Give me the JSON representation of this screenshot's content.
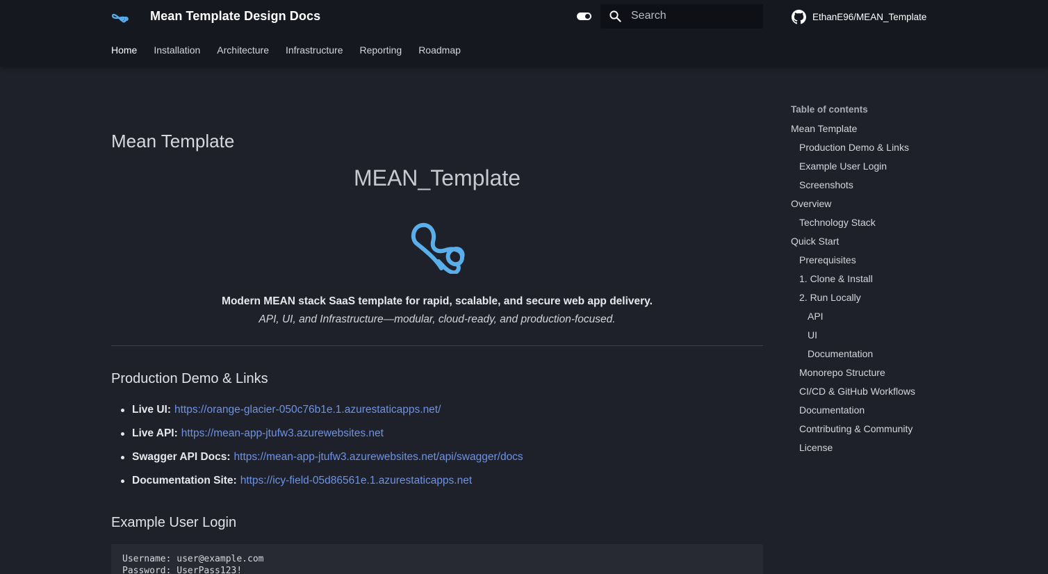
{
  "header": {
    "site_title": "Mean Template Design Docs",
    "search_placeholder": "Search",
    "repo_name": "EthanE96/MEAN_Template",
    "tabs": [
      {
        "label": "Home",
        "active": true
      },
      {
        "label": "Installation"
      },
      {
        "label": "Architecture"
      },
      {
        "label": "Infrastructure"
      },
      {
        "label": "Reporting"
      },
      {
        "label": "Roadmap"
      }
    ]
  },
  "main": {
    "page_title": "Mean Template",
    "center_title": "MEAN_Template",
    "tagline": "Modern MEAN stack SaaS template for rapid, scalable, and secure web app delivery.",
    "subtagline": "API, UI, and Infrastructure—modular, cloud-ready, and production-focused.",
    "section_demo_title": "Production Demo & Links",
    "links": [
      {
        "label": "Live UI:",
        "url": "https://orange-glacier-050c76b1e.1.azurestaticapps.net/"
      },
      {
        "label": "Live API:",
        "url": "https://mean-app-jtufw3.azurewebsites.net"
      },
      {
        "label": "Swagger API Docs:",
        "url": "https://mean-app-jtufw3.azurewebsites.net/api/swagger/docs"
      },
      {
        "label": "Documentation Site:",
        "url": "https://icy-field-05d86561e.1.azurestaticapps.net"
      }
    ],
    "section_login_title": "Example User Login",
    "code_lines": [
      "Username: user@example.com",
      "Password: UserPass123!"
    ]
  },
  "toc": {
    "title": "Table of contents",
    "items": [
      {
        "label": "Mean Template",
        "level": 1
      },
      {
        "label": "Production Demo & Links",
        "level": 2
      },
      {
        "label": "Example User Login",
        "level": 2
      },
      {
        "label": "Screenshots",
        "level": 2
      },
      {
        "label": "Overview",
        "level": 1
      },
      {
        "label": "Technology Stack",
        "level": 2
      },
      {
        "label": "Quick Start",
        "level": 1
      },
      {
        "label": "Prerequisites",
        "level": 2
      },
      {
        "label": "1. Clone & Install",
        "level": 2
      },
      {
        "label": "2. Run Locally",
        "level": 2
      },
      {
        "label": "API",
        "level": 3
      },
      {
        "label": "UI",
        "level": 3
      },
      {
        "label": "Documentation",
        "level": 3
      },
      {
        "label": "Monorepo Structure",
        "level": 2
      },
      {
        "label": "CI/CD & GitHub Workflows",
        "level": 2
      },
      {
        "label": "Documentation",
        "level": 2
      },
      {
        "label": "Contributing & Community",
        "level": 2
      },
      {
        "label": "License",
        "level": 2
      }
    ]
  },
  "colors": {
    "background": "#1e2129",
    "header_background": "#161820",
    "link": "#6d93e6",
    "logo": "#5aaeea"
  },
  "icons": [
    "logo-icon",
    "theme-toggle-icon",
    "search-icon",
    "github-icon"
  ]
}
